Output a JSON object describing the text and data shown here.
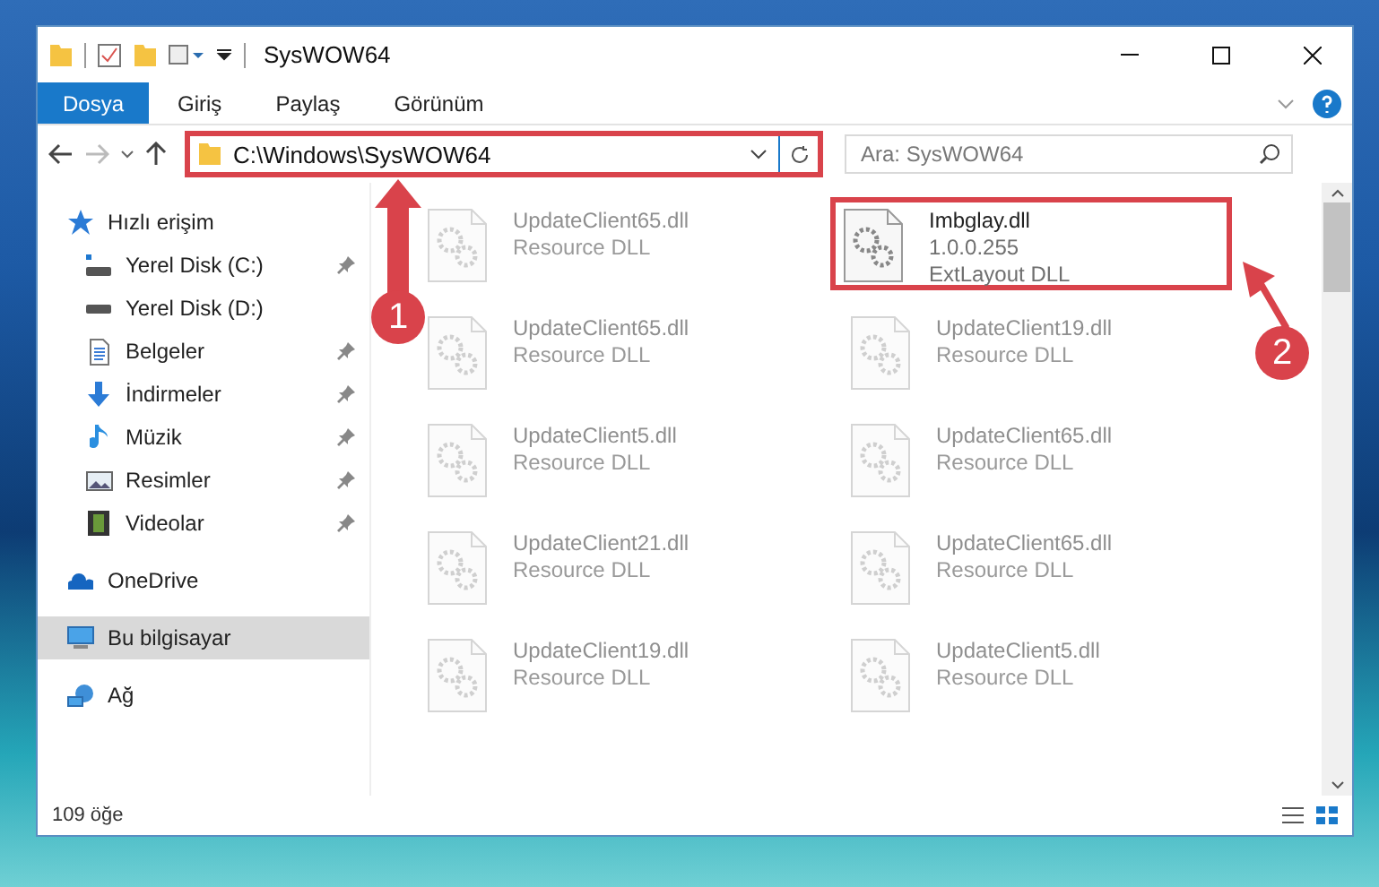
{
  "window": {
    "title": "SysWOW64"
  },
  "ribbon_tabs": [
    {
      "label": "Dosya",
      "selected": true
    },
    {
      "label": "Giriş",
      "selected": false
    },
    {
      "label": "Paylaş",
      "selected": false
    },
    {
      "label": "Görünüm",
      "selected": false
    }
  ],
  "address_bar": {
    "path": "C:\\Windows\\SysWOW64",
    "highlighted": true
  },
  "search": {
    "placeholder": "Ara: SysWOW64"
  },
  "sidebar": {
    "items": [
      {
        "label": "Hızlı erişim",
        "selected": false,
        "children": [
          {
            "label": "Yerel Disk (C:)",
            "pinned": true
          },
          {
            "label": "Yerel Disk (D:)",
            "pinned": false
          },
          {
            "label": "Belgeler",
            "pinned": true
          },
          {
            "label": "İndirmeler",
            "pinned": true
          },
          {
            "label": "Müzik",
            "pinned": true
          },
          {
            "label": "Resimler",
            "pinned": true
          },
          {
            "label": "Videolar",
            "pinned": true
          }
        ]
      },
      {
        "label": "OneDrive",
        "selected": false
      },
      {
        "label": "Bu bilgisayar",
        "selected": true
      },
      {
        "label": "Ağ",
        "selected": false
      }
    ]
  },
  "files": [
    {
      "name": "UpdateClient65.dll",
      "lines": [
        "Resource DLL"
      ],
      "faded": true,
      "highlighted": false
    },
    {
      "name": "Imbglay.dll",
      "lines": [
        "1.0.0.255",
        "ExtLayout DLL"
      ],
      "faded": false,
      "highlighted": true
    },
    {
      "name": "UpdateClient65.dll",
      "lines": [
        "Resource DLL"
      ],
      "faded": true,
      "highlighted": false
    },
    {
      "name": "UpdateClient19.dll",
      "lines": [
        "Resource DLL"
      ],
      "faded": true,
      "highlighted": false
    },
    {
      "name": "UpdateClient5.dll",
      "lines": [
        "Resource DLL"
      ],
      "faded": true,
      "highlighted": false
    },
    {
      "name": "UpdateClient65.dll",
      "lines": [
        "Resource DLL"
      ],
      "faded": true,
      "highlighted": false
    },
    {
      "name": "UpdateClient21.dll",
      "lines": [
        "Resource DLL"
      ],
      "faded": true,
      "highlighted": false
    },
    {
      "name": "UpdateClient65.dll",
      "lines": [
        "Resource DLL"
      ],
      "faded": true,
      "highlighted": false
    },
    {
      "name": "UpdateClient19.dll",
      "lines": [
        "Resource DLL"
      ],
      "faded": true,
      "highlighted": false
    },
    {
      "name": "UpdateClient5.dll",
      "lines": [
        "Resource DLL"
      ],
      "faded": true,
      "highlighted": false
    }
  ],
  "status_bar": {
    "count": "109 öğe"
  },
  "callouts": [
    {
      "number": "1"
    },
    {
      "number": "2"
    }
  ]
}
